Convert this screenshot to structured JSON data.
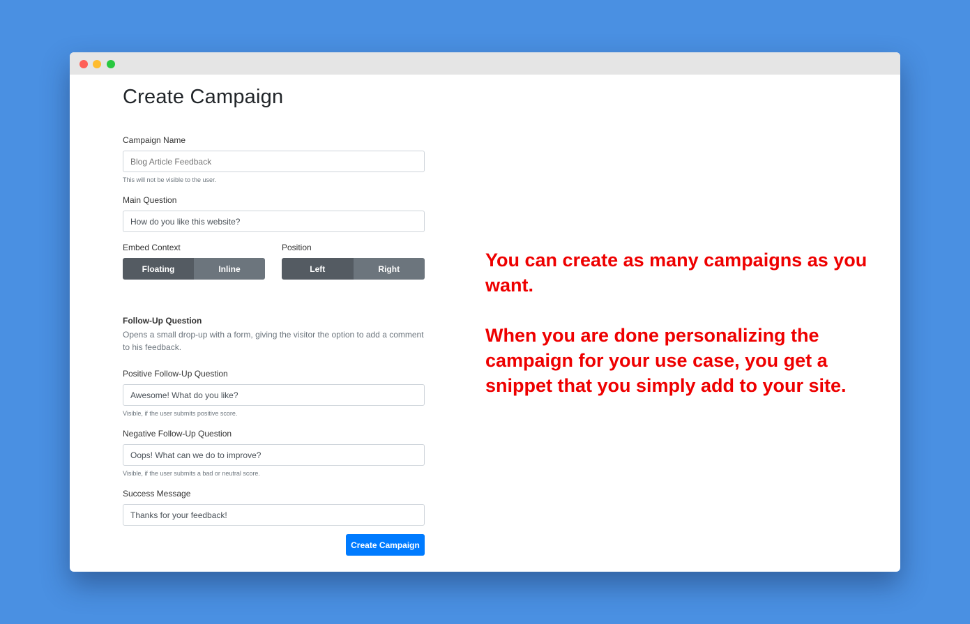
{
  "page": {
    "title": "Create Campaign"
  },
  "fields": {
    "campaign_name": {
      "label": "Campaign Name",
      "placeholder": "Blog Article Feedback",
      "help": "This will not be visible to the user."
    },
    "main_question": {
      "label": "Main Question",
      "value": "How do you like this website?"
    },
    "embed_context": {
      "label": "Embed Context",
      "options": [
        "Floating",
        "Inline"
      ],
      "selected": "Floating"
    },
    "position": {
      "label": "Position",
      "options": [
        "Left",
        "Right"
      ],
      "selected": "Left"
    },
    "follow_up": {
      "label": "Follow-Up Question",
      "description": "Opens a small drop-up with a form, giving the visitor the option to add a comment to his feedback."
    },
    "positive": {
      "label": "Positive Follow-Up Question",
      "value": "Awesome! What do you like?",
      "help": "Visible, if the user submits positive score."
    },
    "negative": {
      "label": "Negative Follow-Up Question",
      "value": "Oops! What can we do to improve?",
      "help": "Visible, if the user submits a bad or neutral score."
    },
    "success": {
      "label": "Success Message",
      "value": "Thanks for your feedback!"
    }
  },
  "actions": {
    "submit_label": "Create Campaign"
  },
  "annotation": {
    "line1": "You can create as many campaigns as you want.",
    "line2": "When you are done personalizing the campaign for your use case, you get a snippet that you simply add to your site."
  },
  "colors": {
    "background": "#4a90e2",
    "primary": "#007bff",
    "annotation": "#ee0000",
    "segment_active": "#545b62",
    "segment": "#6c757d"
  }
}
